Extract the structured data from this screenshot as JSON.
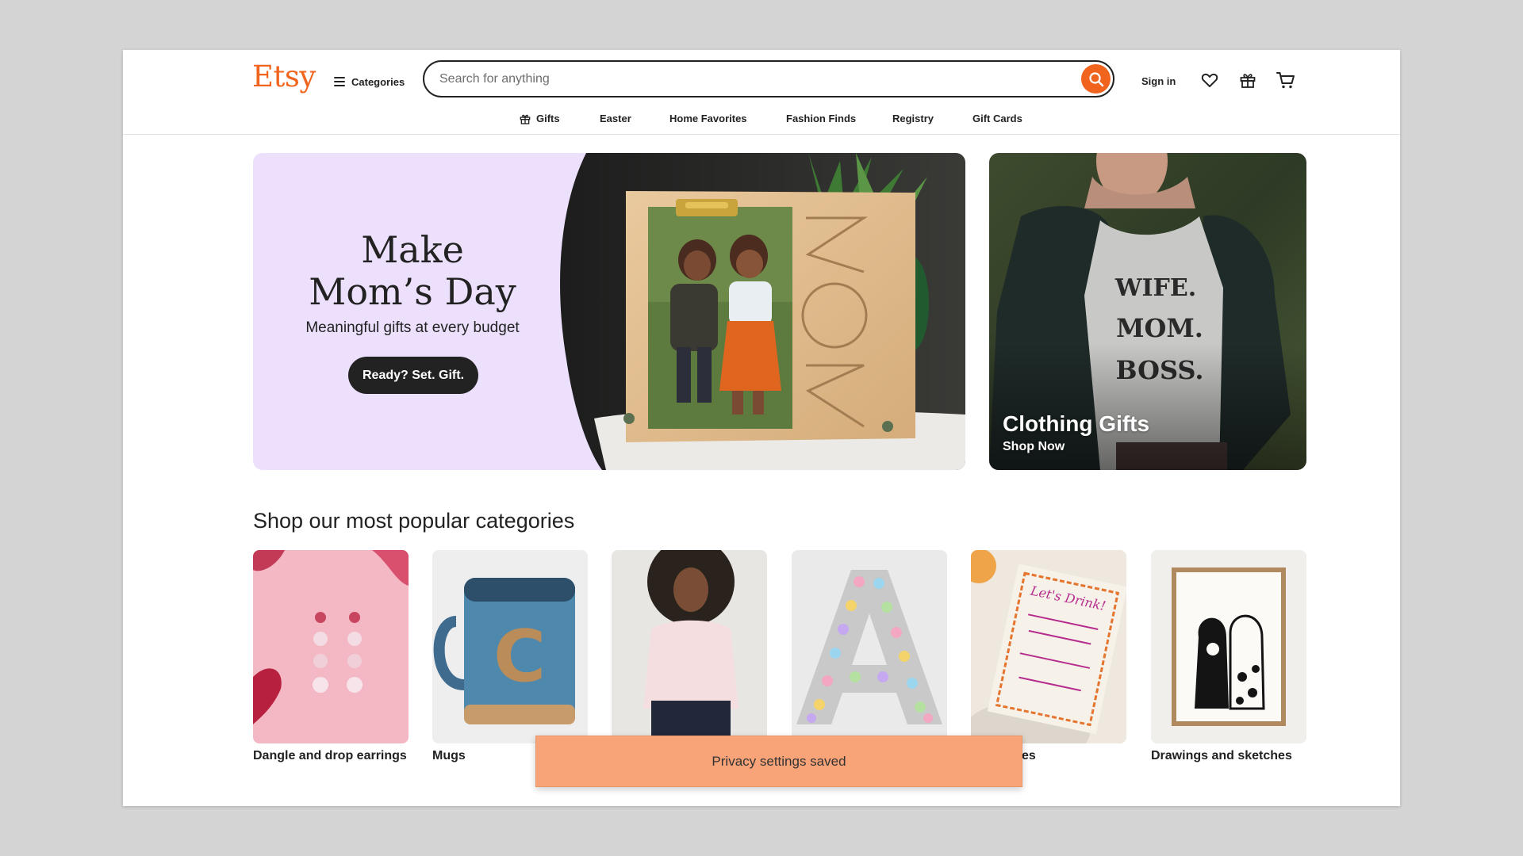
{
  "header": {
    "logo": "Etsy",
    "categories_label": "Categories",
    "search_placeholder": "Search for anything",
    "sign_in": "Sign in"
  },
  "subnav": [
    "Gifts",
    "Easter",
    "Home Favorites",
    "Fashion Finds",
    "Registry",
    "Gift Cards"
  ],
  "hero": {
    "title_line1": "Make",
    "title_line2": "Mom’s Day",
    "subtitle": "Meaningful gifts at every budget",
    "button": "Ready? Set. Gift."
  },
  "side_card": {
    "title": "Clothing Gifts",
    "subtitle": "Shop Now"
  },
  "categories_section": {
    "title": "Shop our most popular categories",
    "items": [
      {
        "label": "Dangle and drop earrings"
      },
      {
        "label": "Mugs"
      },
      {
        "label": ""
      },
      {
        "label": ""
      },
      {
        "label": "es"
      },
      {
        "label": "Drawings and sketches"
      }
    ]
  },
  "toast": {
    "message": "Privacy settings saved"
  },
  "colors": {
    "brand": "#f1641e",
    "toast": "#f8a378",
    "hero_bg": "#ece0fd"
  }
}
